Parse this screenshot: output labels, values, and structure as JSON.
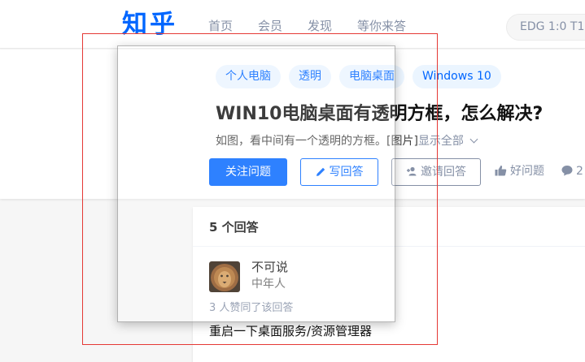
{
  "logo": "知乎",
  "nav": [
    "首页",
    "会员",
    "发现",
    "等你来答"
  ],
  "search": {
    "text": "EDG 1:0 T1"
  },
  "question": {
    "tags": [
      "个人电脑",
      "透明",
      "电脑桌面",
      "Windows 10"
    ],
    "title": "WIN10电脑桌面有透明方框，怎么解决?",
    "description": "如图，看中间有一个透明的方框。[图片]",
    "show_all": "显示全部"
  },
  "actions": {
    "follow": "关注问题",
    "write": "写回答",
    "invite": "邀请回答",
    "good": "好问题",
    "comment": "2"
  },
  "answers": {
    "count_label": "5 个回答",
    "first": {
      "author": "不可说",
      "bio": "中年人",
      "votes": "3 人赞同了该回答",
      "excerpt": "重启一下桌面服务/资源管理器"
    }
  },
  "colors": {
    "brand": "#0066ff",
    "annotation": "#e53935"
  },
  "icons": [
    "pencil-icon",
    "invite-user-icon",
    "thumbs-up-icon",
    "comment-icon",
    "chevron-down-icon"
  ]
}
